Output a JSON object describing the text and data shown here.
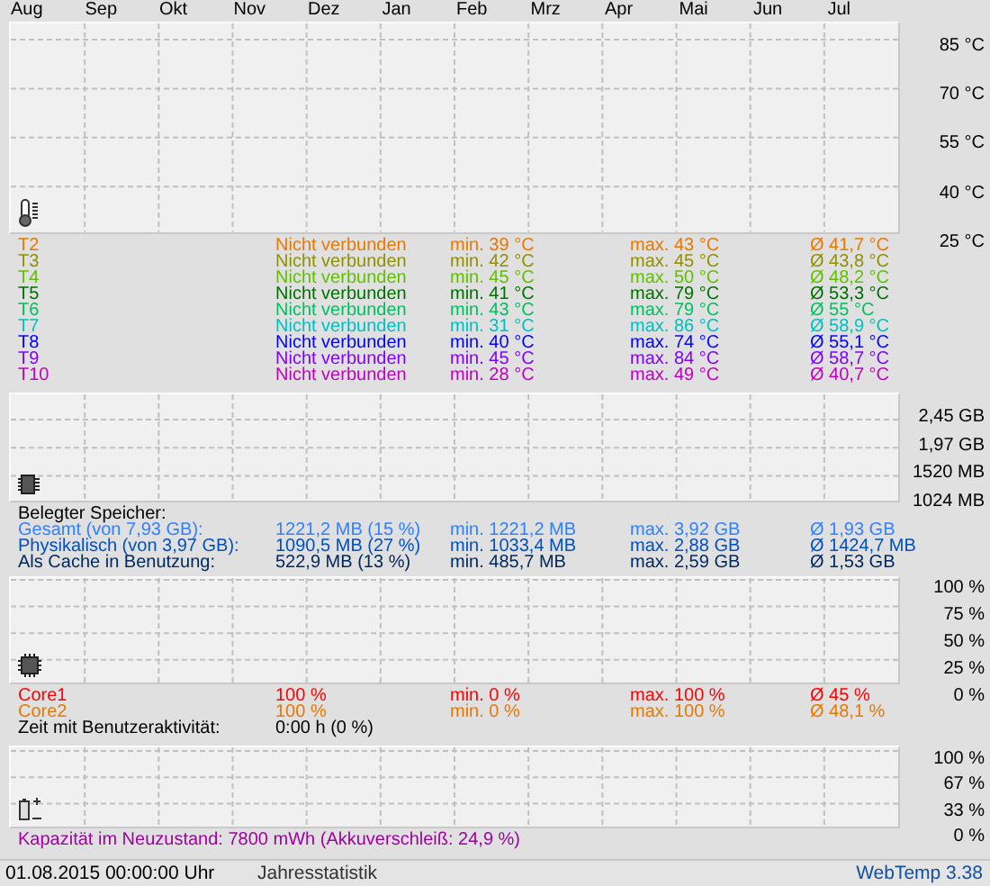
{
  "months": [
    "Aug",
    "Sep",
    "Okt",
    "Nov",
    "Dez",
    "Jan",
    "Feb",
    "Mrz",
    "Apr",
    "Mai",
    "Jun",
    "Jul"
  ],
  "temperature": {
    "axis": [
      "85 °C",
      "70 °C",
      "55 °C",
      "40 °C",
      "25 °C"
    ],
    "sensors": [
      {
        "name": "T2",
        "status": "Nicht verbunden",
        "min": "min. 39 °C",
        "max": "max. 43 °C",
        "avg": "Ø 41,7 °C",
        "color": "#e87800"
      },
      {
        "name": "T3",
        "status": "Nicht verbunden",
        "min": "min. 42 °C",
        "max": "max. 45 °C",
        "avg": "Ø 43,8 °C",
        "color": "#909000"
      },
      {
        "name": "T4",
        "status": "Nicht verbunden",
        "min": "min. 45 °C",
        "max": "max. 50 °C",
        "avg": "Ø 48,2 °C",
        "color": "#60c000"
      },
      {
        "name": "T5",
        "status": "Nicht verbunden",
        "min": "min. 41 °C",
        "max": "max. 79 °C",
        "avg": "Ø 53,3 °C",
        "color": "#007000"
      },
      {
        "name": "T6",
        "status": "Nicht verbunden",
        "min": "min. 43 °C",
        "max": "max. 79 °C",
        "avg": "Ø 55 °C",
        "color": "#00c060"
      },
      {
        "name": "T7",
        "status": "Nicht verbunden",
        "min": "min. 31 °C",
        "max": "max. 86 °C",
        "avg": "Ø 58,9 °C",
        "color": "#00c0c0"
      },
      {
        "name": "T8",
        "status": "Nicht verbunden",
        "min": "min. 40 °C",
        "max": "max. 74 °C",
        "avg": "Ø 55,1 °C",
        "color": "#0000ff"
      },
      {
        "name": "T9",
        "status": "Nicht verbunden",
        "min": "min. 45 °C",
        "max": "max. 84 °C",
        "avg": "Ø 58,7 °C",
        "color": "#8000ff"
      },
      {
        "name": "T10",
        "status": "Nicht verbunden",
        "min": "min. 28 °C",
        "max": "max. 49 °C",
        "avg": "Ø 40,7 °C",
        "color": "#c000c0"
      }
    ]
  },
  "memory": {
    "axis": [
      "2,45 GB",
      "1,97 GB",
      "1520 MB",
      "1024 MB"
    ],
    "heading": "Belegter Speicher:",
    "rows": [
      {
        "label": "Gesamt (von 7,93 GB):",
        "current": "1221,2 MB (15 %)",
        "min": "min. 1221,2 MB",
        "max": "max. 3,92 GB",
        "avg": "Ø 1,93 GB",
        "color": "#3080ff"
      },
      {
        "label": "Physikalisch (von 3,97 GB):",
        "current": "1090,5 MB (27 %)",
        "min": "min. 1033,4 MB",
        "max": "max. 2,88 GB",
        "avg": "Ø 1424,7 MB",
        "color": "#0050c0"
      },
      {
        "label": "Als Cache in Benutzung:",
        "current": "522,9 MB (13 %)",
        "min": "min. 485,7 MB",
        "max": "max. 2,59 GB",
        "avg": "Ø 1,53 GB",
        "color": "#002a60"
      }
    ]
  },
  "cpu": {
    "axis": [
      "100 %",
      "75 %",
      "50 %",
      "25 %",
      "0 %"
    ],
    "cores": [
      {
        "name": "Core1",
        "current": "100 %",
        "min": "min. 0 %",
        "max": "max. 100 %",
        "avg": "Ø 45 %",
        "color": "#ff0000"
      },
      {
        "name": "Core2",
        "current": "100 %",
        "min": "min. 0 %",
        "max": "max. 100 %",
        "avg": "Ø 48,1 %",
        "color": "#e87800"
      }
    ],
    "activity": {
      "label": "Zeit mit Benutzeraktivität:",
      "value": "0:00 h (0 %)"
    }
  },
  "battery": {
    "axis": [
      "100 %",
      "67 %",
      "33 %",
      "0 %"
    ],
    "capacity": "Kapazität im Neuzustand: 7800 mWh (Akkuverschleiß: 24,9 %)"
  },
  "status_bar": {
    "date": "01.08.2015 00:00:00 Uhr",
    "mode": "Jahresstatistik",
    "app": "WebTemp 3.38"
  }
}
